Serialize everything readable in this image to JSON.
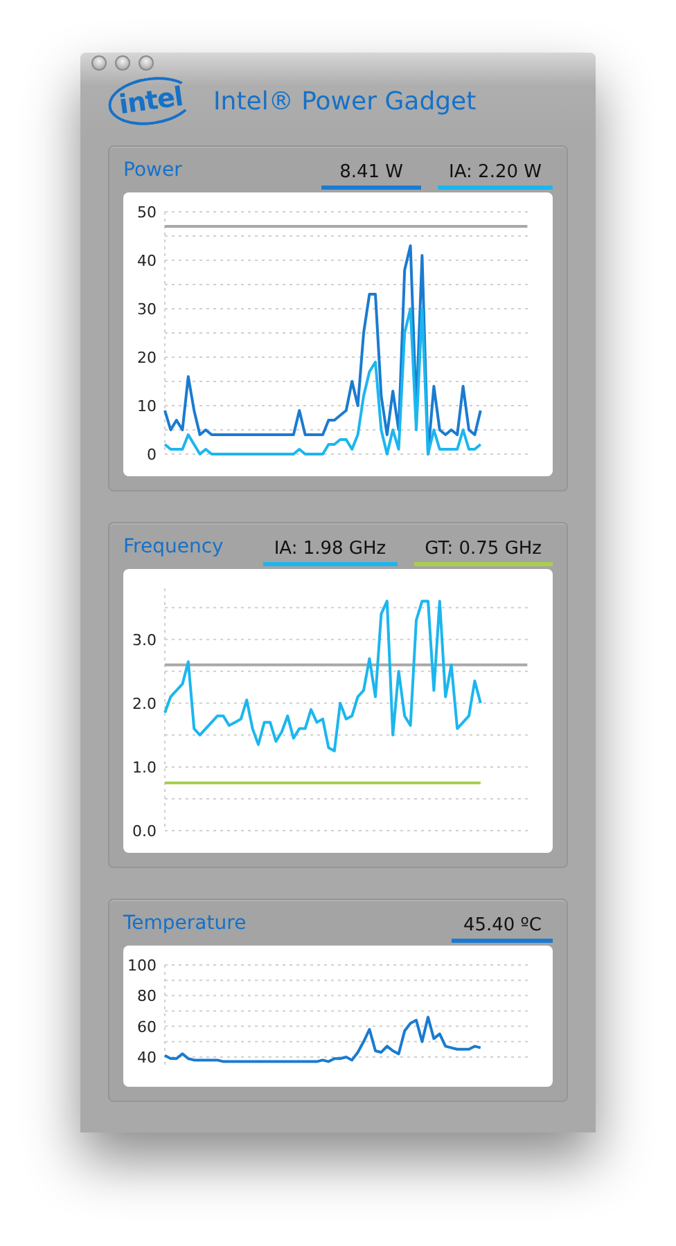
{
  "window": {
    "title": "Intel® Power Gadget",
    "logo": "intel"
  },
  "panels": [
    {
      "title": "Power",
      "legend": [
        {
          "label": "8.41 W",
          "color": "#1a7bd0"
        },
        {
          "label": "IA: 2.20 W",
          "color": "#1cb6ee"
        }
      ],
      "chart_data": {
        "type": "line",
        "grid": true,
        "ylim": [
          0,
          50
        ],
        "yticks": [
          0,
          10,
          20,
          30,
          40,
          50
        ],
        "series": [
          {
            "color": "#a8a8a8",
            "values": [
              47,
              47,
              47,
              47,
              47,
              47,
              47,
              47,
              47,
              47,
              47,
              47,
              47,
              47,
              47,
              47,
              47,
              47,
              47,
              47,
              47,
              47,
              47,
              47,
              47,
              47,
              47,
              47,
              47,
              47,
              47,
              47,
              47,
              47,
              47,
              47,
              47,
              47,
              47,
              47,
              47,
              47,
              47,
              47,
              47,
              47,
              47,
              47,
              47,
              47,
              47,
              47,
              47,
              47,
              47,
              47,
              47,
              47,
              47,
              47,
              47,
              47,
              47
            ]
          },
          {
            "color": "#1a7bd0",
            "values": [
              9,
              5,
              7,
              5,
              16,
              9,
              4,
              5,
              4,
              4,
              4,
              4,
              4,
              4,
              4,
              4,
              4,
              4,
              4,
              4,
              4,
              4,
              4,
              9,
              4,
              4,
              4,
              4,
              7,
              7,
              8,
              9,
              15,
              10,
              25,
              33,
              33,
              12,
              4,
              13,
              5,
              38,
              43,
              9,
              41,
              0,
              14,
              5,
              4,
              5,
              4,
              14,
              5,
              4,
              9
            ]
          },
          {
            "color": "#1cb6ee",
            "values": [
              2,
              1,
              1,
              1,
              4,
              2,
              0,
              1,
              0,
              0,
              0,
              0,
              0,
              0,
              0,
              0,
              0,
              0,
              0,
              0,
              0,
              0,
              0,
              1,
              0,
              0,
              0,
              0,
              2,
              2,
              3,
              3,
              1,
              4,
              12,
              17,
              19,
              5,
              0,
              5,
              1,
              25,
              30,
              5,
              30,
              0,
              5,
              1,
              1,
              1,
              1,
              5,
              1,
              1,
              2
            ]
          }
        ]
      }
    },
    {
      "title": "Frequency",
      "legend": [
        {
          "label": "IA: 1.98 GHz",
          "color": "#1cb6ee"
        },
        {
          "label": "GT: 0.75 GHz",
          "color": "#a8d04a"
        }
      ],
      "chart_data": {
        "type": "line",
        "grid": true,
        "ylim": [
          0,
          3.8
        ],
        "yticks": [
          {
            "value": 0,
            "label": "0.0"
          },
          {
            "value": 1,
            "label": "1.0"
          },
          {
            "value": 2,
            "label": "2.0"
          },
          {
            "value": 3,
            "label": "3.0"
          }
        ],
        "series": [
          {
            "color": "#a8a8a8",
            "values": [
              2.6,
              2.6,
              2.6,
              2.6,
              2.6,
              2.6,
              2.6,
              2.6,
              2.6,
              2.6,
              2.6,
              2.6,
              2.6,
              2.6,
              2.6,
              2.6,
              2.6,
              2.6,
              2.6,
              2.6,
              2.6,
              2.6,
              2.6,
              2.6,
              2.6,
              2.6,
              2.6,
              2.6,
              2.6,
              2.6,
              2.6,
              2.6,
              2.6,
              2.6,
              2.6,
              2.6,
              2.6,
              2.6,
              2.6,
              2.6,
              2.6,
              2.6,
              2.6,
              2.6,
              2.6,
              2.6,
              2.6,
              2.6,
              2.6,
              2.6,
              2.6,
              2.6,
              2.6,
              2.6,
              2.6,
              2.6,
              2.6,
              2.6,
              2.6,
              2.6,
              2.6,
              2.6,
              2.6
            ]
          },
          {
            "color": "#1cb6ee",
            "values": [
              1.85,
              2.1,
              2.2,
              2.3,
              2.65,
              1.6,
              1.5,
              1.6,
              1.7,
              1.8,
              1.8,
              1.65,
              1.7,
              1.75,
              2.05,
              1.6,
              1.35,
              1.7,
              1.7,
              1.4,
              1.55,
              1.8,
              1.45,
              1.6,
              1.6,
              1.9,
              1.7,
              1.75,
              1.3,
              1.25,
              2.0,
              1.75,
              1.8,
              2.1,
              2.2,
              2.7,
              2.1,
              3.4,
              3.6,
              1.5,
              2.5,
              1.8,
              1.65,
              3.3,
              3.6,
              3.6,
              2.2,
              3.6,
              2.1,
              2.6,
              1.6,
              1.7,
              1.8,
              2.35,
              2.0
            ]
          },
          {
            "color": "#a8d04a",
            "values": [
              0.75,
              0.75,
              0.75,
              0.75,
              0.75,
              0.75,
              0.75,
              0.75,
              0.75,
              0.75,
              0.75,
              0.75,
              0.75,
              0.75,
              0.75,
              0.75,
              0.75,
              0.75,
              0.75,
              0.75,
              0.75,
              0.75,
              0.75,
              0.75,
              0.75,
              0.75,
              0.75,
              0.75,
              0.75,
              0.75,
              0.75,
              0.75,
              0.75,
              0.75,
              0.75,
              0.75,
              0.75,
              0.75,
              0.75,
              0.75,
              0.75,
              0.75,
              0.75,
              0.75,
              0.75,
              0.75,
              0.75,
              0.75,
              0.75,
              0.75,
              0.75,
              0.75,
              0.75,
              0.75,
              0.75
            ]
          }
        ]
      }
    },
    {
      "title": "Temperature",
      "legend": [
        {
          "label": "45.40 ºC",
          "color": "#1a7bd0"
        }
      ],
      "chart_data": {
        "type": "line",
        "grid": true,
        "ylim": [
          35,
          100
        ],
        "yticks": [
          40,
          60,
          80,
          100
        ],
        "series": [
          {
            "color": "#1a7bd0",
            "values": [
              41,
              39,
              39,
              42,
              39,
              38,
              38,
              38,
              38,
              38,
              37,
              37,
              37,
              37,
              37,
              37,
              37,
              37,
              37,
              37,
              37,
              37,
              37,
              37,
              37,
              37,
              37,
              38,
              37,
              39,
              39,
              40,
              38,
              43,
              50,
              58,
              44,
              43,
              47,
              44,
              42,
              57,
              62,
              64,
              50,
              66,
              52,
              55,
              47,
              46,
              45,
              45,
              45,
              47,
              46
            ]
          }
        ]
      }
    }
  ]
}
